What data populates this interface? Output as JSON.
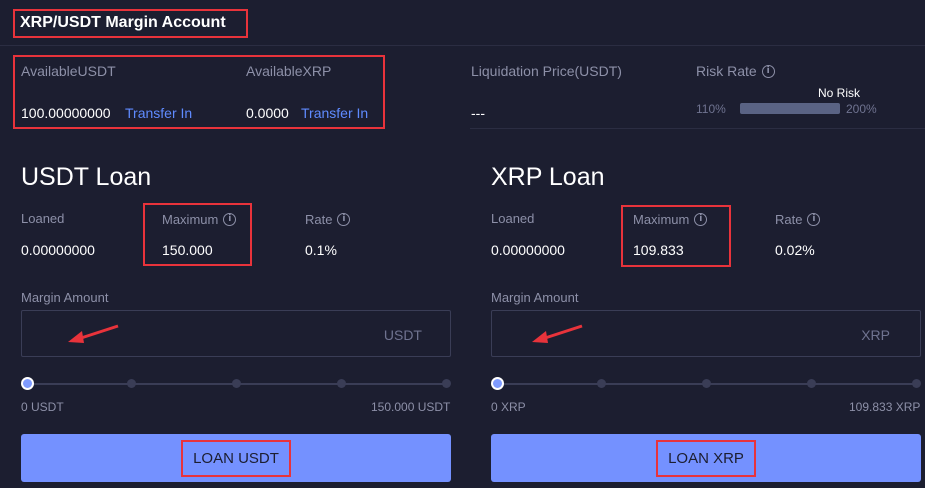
{
  "header": {
    "title": "XRP/USDT Margin Account"
  },
  "account": {
    "available_usdt_label": "AvailableUSDT",
    "available_usdt_value": "100.00000000",
    "available_xrp_label": "AvailableXRP",
    "available_xrp_value": "0.0000",
    "transfer_in_label": "Transfer In",
    "liquidation_label": "Liquidation Price(USDT)",
    "liquidation_value": "---",
    "risk_rate_label": "Risk Rate",
    "risk_status": "No Risk",
    "risk_min_label": "110%",
    "risk_max_label": "200%"
  },
  "usdt_loan": {
    "title": "USDT Loan",
    "loaned_label": "Loaned",
    "loaned_value": "0.00000000",
    "maximum_label": "Maximum",
    "maximum_value": "150.000",
    "rate_label": "Rate",
    "rate_value": "0.1%",
    "margin_amount_label": "Margin Amount",
    "unit": "USDT",
    "slider_min": "0 USDT",
    "slider_max": "150.000 USDT",
    "button_label": "LOAN USDT"
  },
  "xrp_loan": {
    "title": "XRP Loan",
    "loaned_label": "Loaned",
    "loaned_value": "0.00000000",
    "maximum_label": "Maximum",
    "maximum_value": "109.833",
    "rate_label": "Rate",
    "rate_value": "0.02%",
    "margin_amount_label": "Margin Amount",
    "unit": "XRP",
    "slider_min": "0 XRP",
    "slider_max": "109.833 XRP",
    "button_label": "LOAN XRP"
  },
  "icons": {
    "info": "info-icon",
    "arrow": "red-arrow-annotation"
  },
  "colors": {
    "background": "#1c1e30",
    "accent": "#7491ff",
    "link": "#5f8bff",
    "annotation_red": "#e8333b"
  }
}
